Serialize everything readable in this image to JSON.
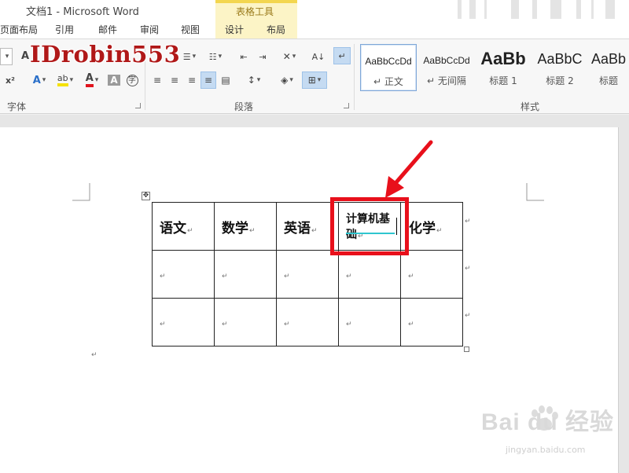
{
  "window": {
    "title": "文档1 - Microsoft Word"
  },
  "contextual": {
    "label": "表格工具"
  },
  "tabs": [
    "页面布局",
    "引用",
    "邮件",
    "审阅",
    "视图",
    "设计",
    "布局"
  ],
  "watermark": {
    "id_text": "IDrobin553",
    "baidu": "Bai du 经验",
    "url": "jingyan.baidu.com"
  },
  "ribbon": {
    "groups": {
      "font": "字体",
      "paragraph": "段落",
      "styles": "样式"
    },
    "styles": [
      {
        "preview": "AaBbCcDd",
        "name": "正文",
        "active": true
      },
      {
        "preview": "AaBbCcDd",
        "name": "无间隔",
        "active": false
      },
      {
        "preview": "AaBb",
        "name": "标题 1",
        "active": false
      },
      {
        "preview": "AaBbC",
        "name": "标题 2",
        "active": false
      },
      {
        "preview": "AaBb",
        "name": "标题",
        "active": false
      }
    ]
  },
  "table": {
    "header": [
      "语文",
      "数学",
      "英语",
      "计算机基础",
      "化学"
    ],
    "rows": [
      [
        "",
        "",
        "",
        "",
        ""
      ],
      [
        "",
        "",
        "",
        "",
        ""
      ]
    ]
  },
  "colors": {
    "accent_red": "#e8101b",
    "contextual_yellow": "#fcf4c6",
    "spell_underline": "#2fc6cf"
  }
}
